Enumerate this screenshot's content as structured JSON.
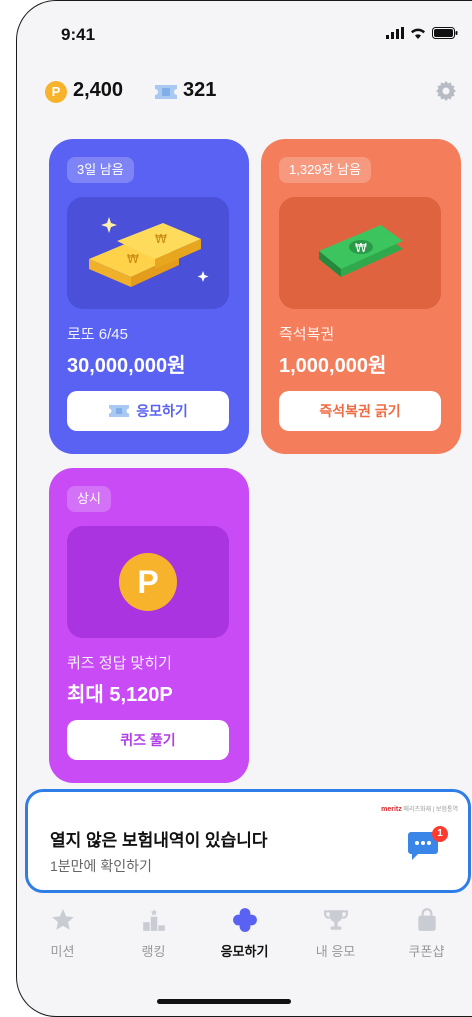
{
  "status_bar": {
    "time": "9:41"
  },
  "header": {
    "points": "2,400",
    "tickets": "321",
    "coin_letter": "P"
  },
  "cards": {
    "lotto": {
      "badge": "3일 남음",
      "subtitle": "로또 6/45",
      "amount": "30,000,000원",
      "button": "응모하기"
    },
    "instant": {
      "badge": "1,329장 남음",
      "subtitle": "즉석복권",
      "amount": "1,000,000원",
      "button": "즉석복권 긁기"
    },
    "quiz": {
      "badge": "상시",
      "subtitle": "퀴즈 정답 맞히기",
      "amount": "최대 5,120P",
      "button": "퀴즈 풀기",
      "coin_letter": "P"
    }
  },
  "banner": {
    "title": "열지 않은 보험내역이 있습니다",
    "subtitle": "1분만에 확인하기",
    "brand": "meritz",
    "brand_sub": "메리츠화재 | 보험통역",
    "notification_count": "1"
  },
  "tabbar": {
    "items": [
      {
        "label": "미션",
        "icon": "star-icon"
      },
      {
        "label": "랭킹",
        "icon": "podium-icon"
      },
      {
        "label": "응모하기",
        "icon": "flower-icon",
        "active": true
      },
      {
        "label": "내 응모",
        "icon": "trophy-icon"
      },
      {
        "label": "쿠폰샵",
        "icon": "shopping-bag-icon"
      }
    ]
  },
  "colors": {
    "lotto": "#5a62f3",
    "instant": "#f47d5b",
    "quiz": "#c84bf5",
    "banner_border": "#2f7ee8",
    "active_tab": "#5a62f3"
  }
}
